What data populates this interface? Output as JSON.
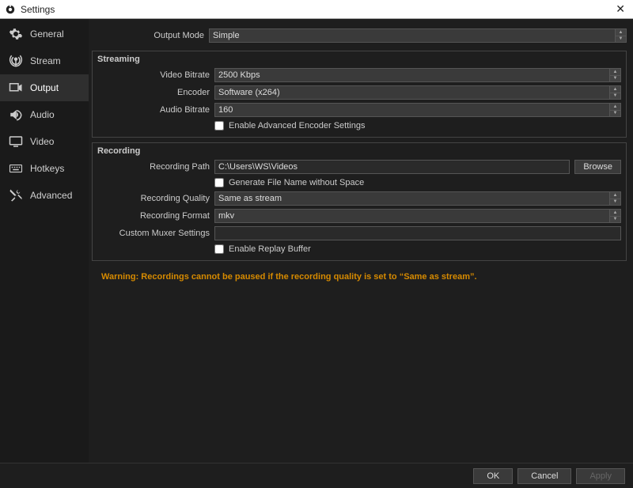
{
  "window": {
    "title": "Settings"
  },
  "sidebar": {
    "items": [
      {
        "label": "General"
      },
      {
        "label": "Stream"
      },
      {
        "label": "Output"
      },
      {
        "label": "Audio"
      },
      {
        "label": "Video"
      },
      {
        "label": "Hotkeys"
      },
      {
        "label": "Advanced"
      }
    ]
  },
  "outputMode": {
    "label": "Output Mode",
    "value": "Simple"
  },
  "streaming": {
    "title": "Streaming",
    "videoBitrate": {
      "label": "Video Bitrate",
      "value": "2500 Kbps"
    },
    "encoder": {
      "label": "Encoder",
      "value": "Software (x264)"
    },
    "audioBitrate": {
      "label": "Audio Bitrate",
      "value": "160"
    },
    "advanced": {
      "label": "Enable Advanced Encoder Settings",
      "checked": false
    }
  },
  "recording": {
    "title": "Recording",
    "path": {
      "label": "Recording Path",
      "value": "C:\\Users\\WS\\Videos",
      "browse": "Browse"
    },
    "noSpace": {
      "label": "Generate File Name without Space",
      "checked": false
    },
    "quality": {
      "label": "Recording Quality",
      "value": "Same as stream"
    },
    "format": {
      "label": "Recording Format",
      "value": "mkv"
    },
    "muxer": {
      "label": "Custom Muxer Settings",
      "value": ""
    },
    "replay": {
      "label": "Enable Replay Buffer",
      "checked": false
    }
  },
  "warning": "Warning: Recordings cannot be paused if the recording quality is set to “Same as stream”.",
  "footer": {
    "ok": "OK",
    "cancel": "Cancel",
    "apply": "Apply"
  }
}
